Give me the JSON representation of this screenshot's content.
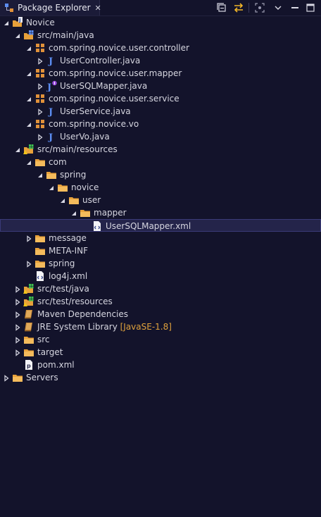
{
  "view": {
    "title": "Package Explorer",
    "icon": "package-explorer-icon",
    "close_glyph": "✕",
    "toolbar": [
      "collapse-all-icon",
      "link-with-editor-icon",
      "focus-icon",
      "view-menu-icon",
      "minimize-icon",
      "maximize-icon"
    ]
  },
  "tree": [
    {
      "label": "Novice",
      "depth": 0,
      "toggle": "expanded",
      "icon": "java-project-icon"
    },
    {
      "label": "src/main/java",
      "depth": 1,
      "toggle": "expanded",
      "icon": "source-folder-icon"
    },
    {
      "label": "com.spring.novice.user.controller",
      "depth": 2,
      "toggle": "expanded",
      "icon": "package-icon"
    },
    {
      "label": "UserController.java",
      "depth": 3,
      "toggle": "collapsed",
      "icon": "java-class-icon"
    },
    {
      "label": "com.spring.novice.user.mapper",
      "depth": 2,
      "toggle": "expanded",
      "icon": "package-icon"
    },
    {
      "label": "UserSQLMapper.java",
      "depth": 3,
      "toggle": "collapsed",
      "icon": "java-interface-icon"
    },
    {
      "label": "com.spring.novice.user.service",
      "depth": 2,
      "toggle": "expanded",
      "icon": "package-icon"
    },
    {
      "label": "UserService.java",
      "depth": 3,
      "toggle": "collapsed",
      "icon": "java-class-icon"
    },
    {
      "label": "com.spring.novice.vo",
      "depth": 2,
      "toggle": "expanded",
      "icon": "package-icon"
    },
    {
      "label": "UserVo.java",
      "depth": 3,
      "toggle": "collapsed",
      "icon": "java-class-icon"
    },
    {
      "label": "src/main/resources",
      "depth": 1,
      "toggle": "expanded",
      "icon": "source-folder-warning-icon"
    },
    {
      "label": "com",
      "depth": 2,
      "toggle": "expanded",
      "icon": "folder-icon"
    },
    {
      "label": "spring",
      "depth": 3,
      "toggle": "expanded",
      "icon": "folder-icon"
    },
    {
      "label": "novice",
      "depth": 4,
      "toggle": "expanded",
      "icon": "folder-icon"
    },
    {
      "label": "user",
      "depth": 5,
      "toggle": "expanded",
      "icon": "folder-icon"
    },
    {
      "label": "mapper",
      "depth": 6,
      "toggle": "expanded",
      "icon": "folder-icon"
    },
    {
      "label": "UserSQLMapper.xml",
      "depth": 7,
      "toggle": "none",
      "icon": "xml-file-icon",
      "selected": true
    },
    {
      "label": "message",
      "depth": 2,
      "toggle": "collapsed",
      "icon": "folder-icon"
    },
    {
      "label": "META-INF",
      "depth": 2,
      "toggle": "none",
      "icon": "folder-icon"
    },
    {
      "label": "spring",
      "depth": 2,
      "toggle": "collapsed",
      "icon": "folder-icon"
    },
    {
      "label": "log4j.xml",
      "depth": 2,
      "toggle": "none",
      "icon": "xml-file-icon"
    },
    {
      "label": "src/test/java",
      "depth": 1,
      "toggle": "collapsed",
      "icon": "source-folder-warning-icon"
    },
    {
      "label": "src/test/resources",
      "depth": 1,
      "toggle": "collapsed",
      "icon": "source-folder-warning-icon"
    },
    {
      "label": "Maven Dependencies",
      "depth": 1,
      "toggle": "collapsed",
      "icon": "library-icon"
    },
    {
      "label": "JRE System Library",
      "decoration": "[JavaSE-1.8]",
      "depth": 1,
      "toggle": "collapsed",
      "icon": "library-icon"
    },
    {
      "label": "src",
      "depth": 1,
      "toggle": "collapsed",
      "icon": "folder-icon"
    },
    {
      "label": "target",
      "depth": 1,
      "toggle": "collapsed",
      "icon": "folder-icon"
    },
    {
      "label": "pom.xml",
      "depth": 1,
      "toggle": "none",
      "icon": "pom-file-icon"
    },
    {
      "label": "Servers",
      "depth": 0,
      "toggle": "collapsed",
      "icon": "folder-icon"
    }
  ],
  "colors": {
    "background": "#13132b",
    "folder": "#e8a13a",
    "package": "#e0913a",
    "java_letter": "#5b8cf0",
    "selection": "#24244a",
    "decoration": "#e0a23c"
  }
}
